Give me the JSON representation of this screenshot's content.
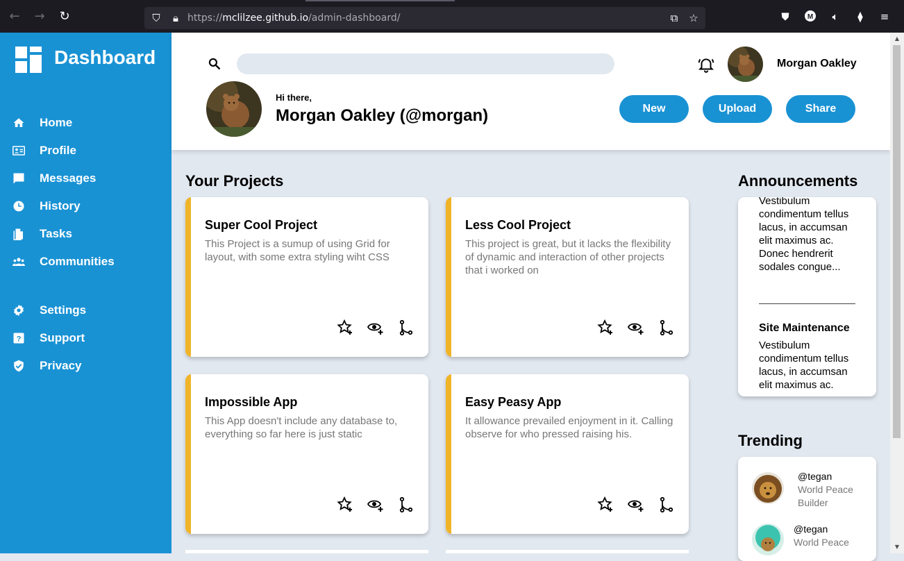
{
  "browser": {
    "url_prefix": "https://",
    "url_host": "mclilzee.github.io",
    "url_path": "/admin-dashboard/",
    "back_icon": "arrow-left-icon",
    "forward_icon": "arrow-right-icon",
    "reload_icon": "reload-icon"
  },
  "sidebar": {
    "brand": "Dashboard",
    "items": [
      {
        "label": "Home",
        "icon": "home-icon"
      },
      {
        "label": "Profile",
        "icon": "profile-card-icon"
      },
      {
        "label": "Messages",
        "icon": "message-icon"
      },
      {
        "label": "History",
        "icon": "clock-icon"
      },
      {
        "label": "Tasks",
        "icon": "file-icon"
      },
      {
        "label": "Communities",
        "icon": "group-icon"
      },
      {
        "label": "Settings",
        "icon": "gear-icon"
      },
      {
        "label": "Support",
        "icon": "help-icon"
      },
      {
        "label": "Privacy",
        "icon": "shield-icon"
      }
    ]
  },
  "header": {
    "search_placeholder": "",
    "user_name": "Morgan Oakley",
    "greeting": "Hi there,",
    "full_name": "Morgan Oakley (@morgan)",
    "buttons": {
      "new": "New",
      "upload": "Upload",
      "share": "Share"
    }
  },
  "projects": {
    "title": "Your Projects",
    "cards": [
      {
        "title": "Super Cool Project",
        "desc": "This Project is a sumup of using Grid for layout, with some extra styling wiht CSS"
      },
      {
        "title": "Less Cool Project",
        "desc": "This project is great, but it lacks the flexibility of dynamic and interaction of other projects that i worked on"
      },
      {
        "title": "Impossible App",
        "desc": "This App doesn't include any database to, everything so far here is just static"
      },
      {
        "title": "Easy Peasy App",
        "desc": "It allowance prevailed enjoyment in it. Calling observe for who pressed raising his."
      }
    ]
  },
  "announcements": {
    "title": "Announcements",
    "first_text": "Vestibulum condimentum tellus lacus, in accumsan elit maximus ac. Donec hendrerit sodales congue...",
    "second_title": "Site Maintenance",
    "second_text": "Vestibulum condimentum tellus lacus, in accumsan elit maximus ac."
  },
  "trending": {
    "title": "Trending",
    "items": [
      {
        "handle": "@tegan",
        "desc": "World Peace Builder"
      },
      {
        "handle": "@tegan",
        "desc": "World Peace"
      }
    ]
  },
  "colors": {
    "sidebar": "#1992d4",
    "accent": "#f0b429",
    "background": "#e2e8f0"
  }
}
